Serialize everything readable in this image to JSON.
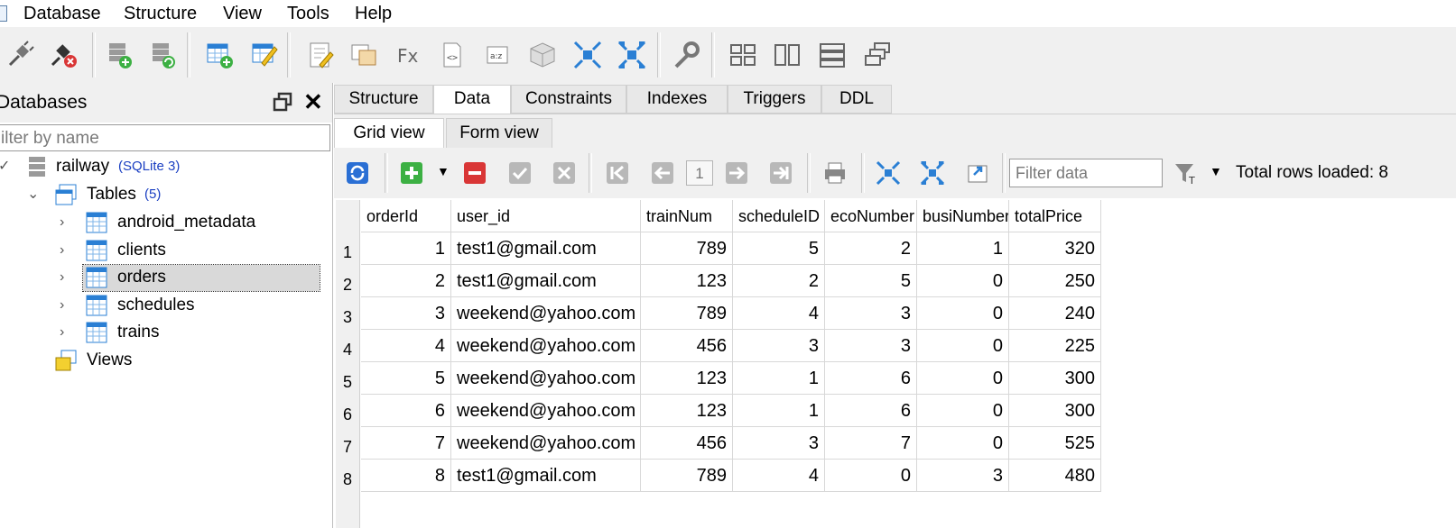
{
  "menu": [
    "Database",
    "Structure",
    "View",
    "Tools",
    "Help"
  ],
  "left_panel": {
    "title": "Databases",
    "filter_placeholder": "ilter by name",
    "database": {
      "name": "railway",
      "type": "(SQLite 3)"
    },
    "tables_label": "Tables",
    "tables_count": "(5)",
    "tables": [
      "android_metadata",
      "clients",
      "orders",
      "schedules",
      "trains"
    ],
    "selected_table": "orders",
    "views_label": "Views"
  },
  "tabs": [
    "Structure",
    "Data",
    "Constraints",
    "Indexes",
    "Triggers",
    "DDL"
  ],
  "active_tab": "Data",
  "subtabs": [
    "Grid view",
    "Form view"
  ],
  "active_subtab": "Grid view",
  "grid_toolbar": {
    "page": "1",
    "filter_placeholder": "Filter data",
    "rows_loaded": "Total rows loaded: 8"
  },
  "grid": {
    "columns": [
      "orderId",
      "user_id",
      "trainNum",
      "scheduleID",
      "ecoNumber",
      "busiNumber",
      "totalPrice"
    ],
    "row_numbers": [
      "1",
      "2",
      "3",
      "4",
      "5",
      "6",
      "7",
      "8"
    ],
    "rows": [
      [
        "1",
        "test1@gmail.com",
        "789",
        "5",
        "2",
        "1",
        "320"
      ],
      [
        "2",
        "test1@gmail.com",
        "123",
        "2",
        "5",
        "0",
        "250"
      ],
      [
        "3",
        "weekend@yahoo.com",
        "789",
        "4",
        "3",
        "0",
        "240"
      ],
      [
        "4",
        "weekend@yahoo.com",
        "456",
        "3",
        "3",
        "0",
        "225"
      ],
      [
        "5",
        "weekend@yahoo.com",
        "123",
        "1",
        "6",
        "0",
        "300"
      ],
      [
        "6",
        "weekend@yahoo.com",
        "123",
        "1",
        "6",
        "0",
        "300"
      ],
      [
        "7",
        "weekend@yahoo.com",
        "456",
        "3",
        "7",
        "0",
        "525"
      ],
      [
        "8",
        "test1@gmail.com",
        "789",
        "4",
        "0",
        "3",
        "480"
      ]
    ]
  },
  "colors": {
    "accent_blue": "#1a3fc2",
    "add_green": "#3cb043",
    "delete_red": "#d93636"
  }
}
